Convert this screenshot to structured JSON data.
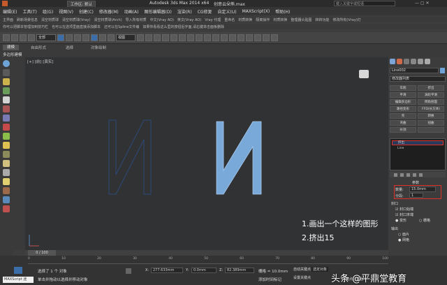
{
  "title": {
    "workspace_label": "工作区: 默认",
    "app": "Autodesk 3ds Max  2014 x64",
    "file": "创意云朵熊.max",
    "search_placeholder": "键入关键字或短语"
  },
  "menu": [
    "编辑(E)",
    "工具(T)",
    "组(G)",
    "视图(V)",
    "创建(C)",
    "修改器(M)",
    "动画(A)",
    "图形编辑器(D)",
    "渲染(R)",
    "CG修复",
    "自定义(U)",
    "MAXScript(X)",
    "帮助(H)"
  ],
  "shortcut_row1": [
    "主界面",
    "刷新场景信息",
    "清空材质球",
    "清空材质球(Vray)",
    "清空材质球(Arch)",
    "导入所有材质",
    "中文(Vray AO)",
    "英文(Vray AO)",
    "Vray 代理",
    "重命名",
    "材质转换",
    "隔离操作",
    "材质转换",
    "整理器头贴图",
    "转转功能",
    "修改所有(Vray)灯"
  ],
  "shortcut_row2": [
    "你可以把脚本管理加到技巧栏",
    "也可以在选项里面直接添加脚本",
    "还可以在Spline文件编",
    "如果你看看这么里的按钮后字面,请右键单击面板删除"
  ],
  "toolbar": {
    "dropdown": "全部",
    "view": "视图"
  },
  "ribbon": {
    "tab_active": "建模",
    "tabs": [
      "自由形式",
      "选择",
      "对象绘制"
    ],
    "sub": "多边形建模"
  },
  "viewport": {
    "label": "[+] [前] [真实]",
    "annotation1": "1.画出一个这样的图形",
    "annotation2": "2.挤出15",
    "frame": "0 / 100"
  },
  "command_panel": {
    "object_name": "Line002",
    "modifier_list": "修改器列表",
    "buttons": [
      [
        "车削",
        "挤出"
      ],
      [
        "平滑",
        "涡轮平滑"
      ],
      [
        "编辑多边形",
        "倒角剖面"
      ],
      [
        "路径变形",
        "FFD(长方体)"
      ],
      [
        "壳",
        "转换"
      ],
      [
        "弯曲",
        "扭曲"
      ],
      [
        "补洞",
        ""
      ]
    ],
    "stack": [
      "挤出",
      "Line"
    ],
    "params_title": "参数",
    "amount_label": "数量:",
    "amount_value": "15.0mm",
    "segments_label": "分段:",
    "segments_value": "1",
    "cap_title": "封口",
    "cap_start": "封口始端",
    "cap_end": "封口末端",
    "morph": "变形",
    "grid": "栅格",
    "output_title": "输出",
    "patch": "面片",
    "mesh": "网格"
  },
  "status": {
    "maxscript": "MAXScript 迷",
    "selected": "选择了 1 个 对象",
    "hint": "单击并拖动以选择并移动对象",
    "x": "277.633mm",
    "y": "0.0mm",
    "z": "82.389mm",
    "grid": "栅格 = 10.0mm",
    "add_time_tag": "添加时间标记",
    "autokey": "自动关键点",
    "selected_obj": "选定对象",
    "set_key": "设置关键点",
    "key_filter": "关键点过滤器...",
    "ticks": [
      "0",
      "10",
      "20",
      "30",
      "40",
      "50",
      "60",
      "70",
      "80",
      "90",
      "100"
    ]
  },
  "watermark": "头条 @平鼎堂教育",
  "colors": {
    "accent": "#3b6ea8",
    "shape_fill": "#79a9d8",
    "highlight": "#e0302a"
  }
}
